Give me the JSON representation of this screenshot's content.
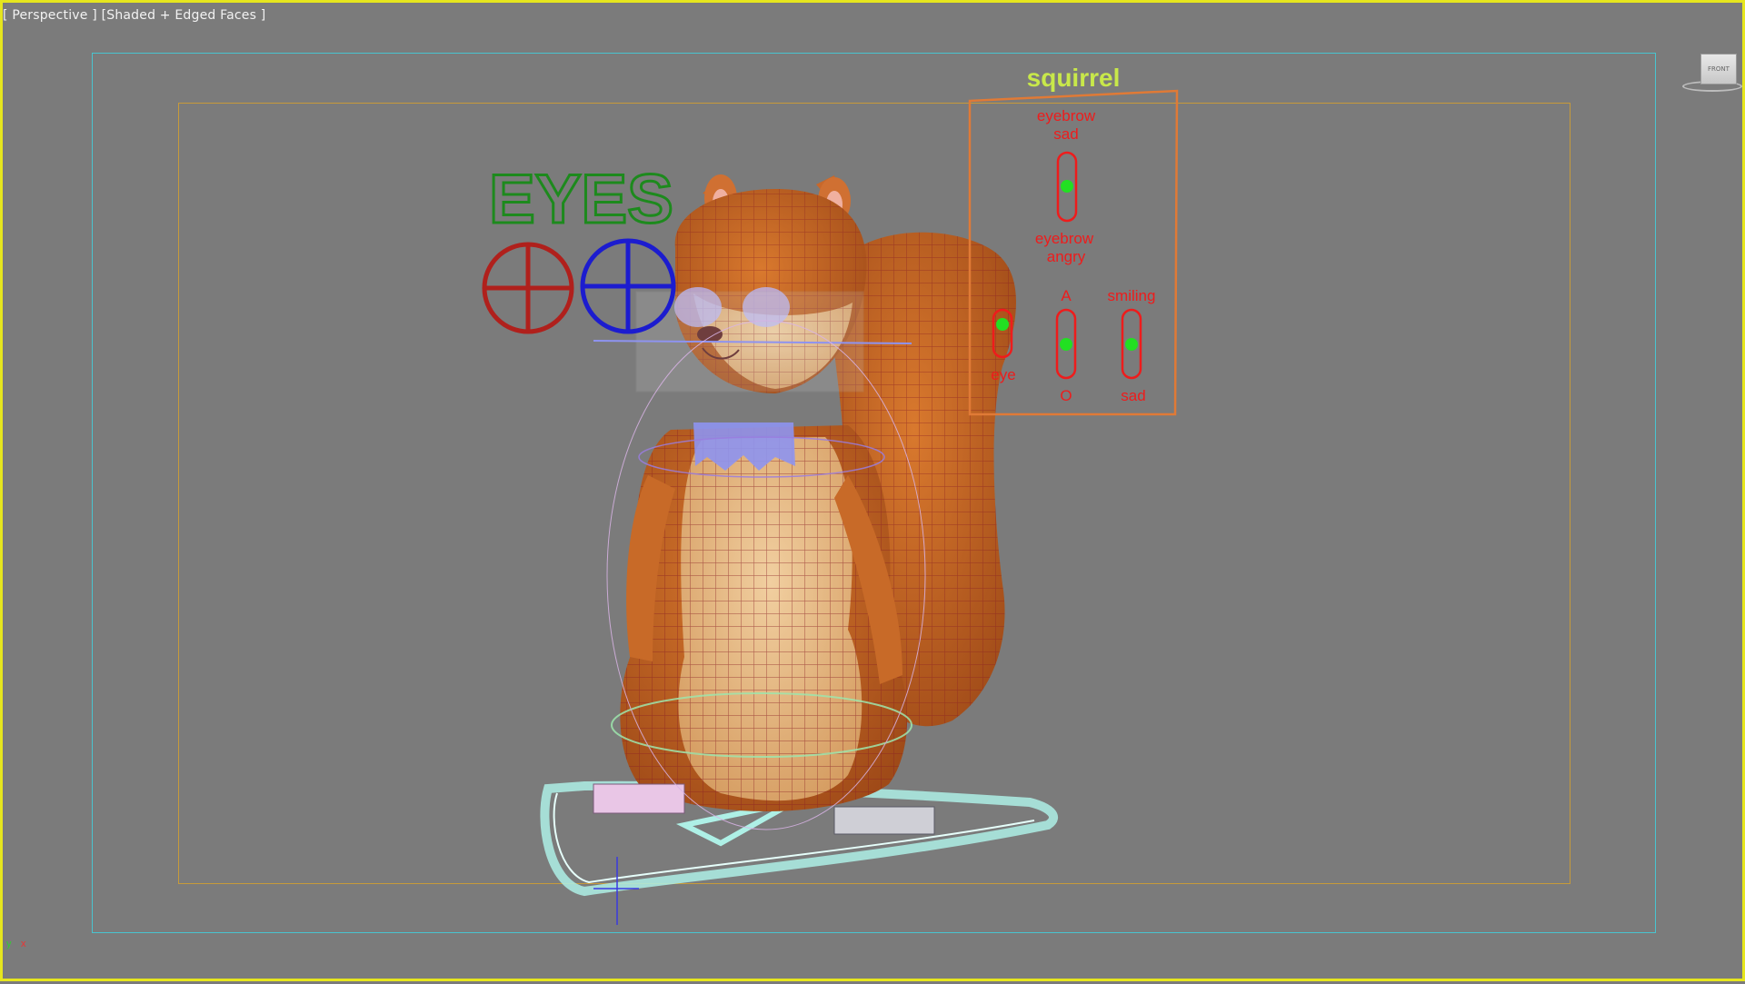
{
  "viewport": {
    "label_view": "Perspective",
    "label_mode": "Shaded + Edged Faces",
    "border_color": "#e6e61e",
    "background": "#7b7b7b"
  },
  "viewcube": {
    "face_label": "FRONT"
  },
  "eyes_control": {
    "title": "EYES",
    "title_color": "#1d8a1d",
    "left_circle_color": "#b0201c",
    "right_circle_color": "#1c1ccf"
  },
  "face_panel": {
    "title": "squirrel",
    "title_color": "#c8e84a",
    "frame_color": "#e07a36",
    "label_color": "#ee1c1c",
    "slider_knob_color": "#22e022",
    "eyebrow_top_label_1": "eyebrow",
    "eyebrow_top_label_2": "sad",
    "eyebrow_bottom_label_1": "eyebrow",
    "eyebrow_bottom_label_2": "angry",
    "mouth_top_label": "A",
    "mouth_bottom_label": "O",
    "smile_top_label": "smiling",
    "smile_bottom_label": "sad",
    "eye_label": "eye"
  },
  "axis": {
    "x": "x",
    "y": "y"
  }
}
